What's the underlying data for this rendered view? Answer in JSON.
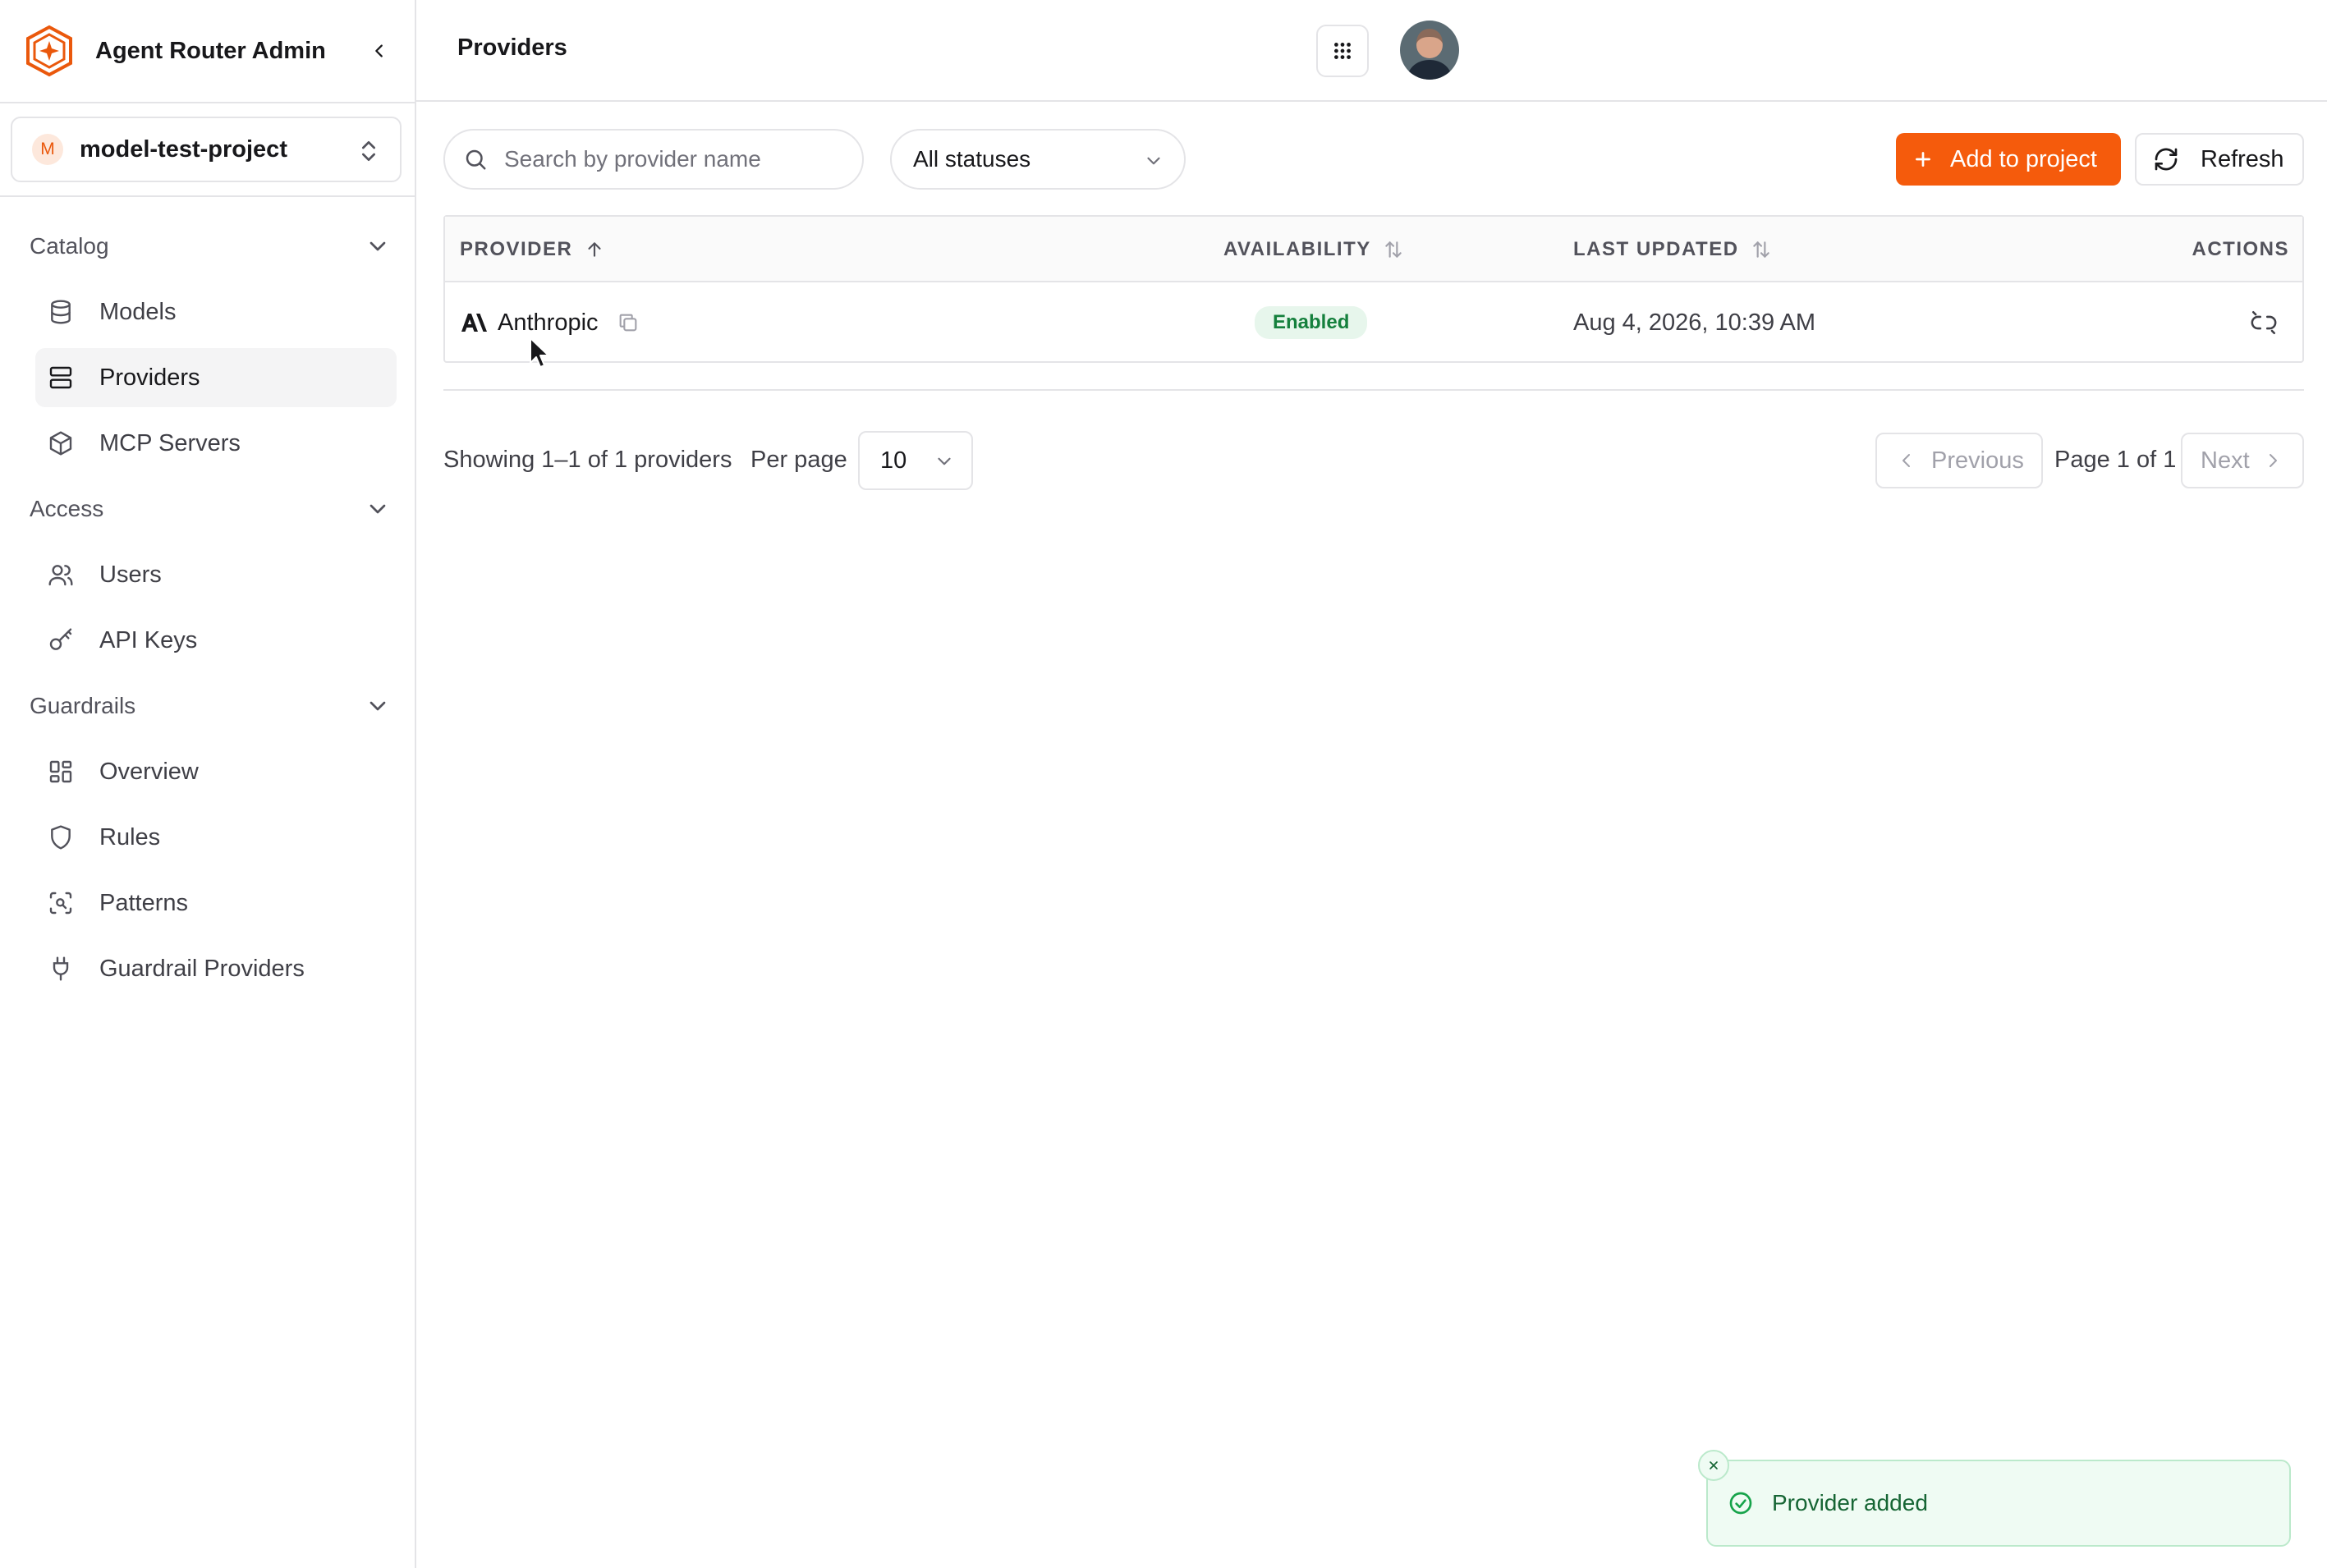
{
  "app": {
    "title": "Agent Router Admin",
    "accent_color": "#f55b0c"
  },
  "project": {
    "initial": "M",
    "name": "model-test-project"
  },
  "sidebar": {
    "sections": [
      {
        "label": "Catalog",
        "items": [
          {
            "label": "Models",
            "icon": "database-icon",
            "active": false
          },
          {
            "label": "Providers",
            "icon": "server-icon",
            "active": true
          },
          {
            "label": "MCP Servers",
            "icon": "package-icon",
            "active": false
          }
        ]
      },
      {
        "label": "Access",
        "items": [
          {
            "label": "Users",
            "icon": "users-icon",
            "active": false
          },
          {
            "label": "API Keys",
            "icon": "key-icon",
            "active": false
          }
        ]
      },
      {
        "label": "Guardrails",
        "items": [
          {
            "label": "Overview",
            "icon": "dashboard-icon",
            "active": false
          },
          {
            "label": "Rules",
            "icon": "shield-icon",
            "active": false
          },
          {
            "label": "Patterns",
            "icon": "scan-search-icon",
            "active": false
          },
          {
            "label": "Guardrail Providers",
            "icon": "plug-icon",
            "active": false
          }
        ]
      }
    ]
  },
  "header": {
    "page_title": "Providers"
  },
  "toolbar": {
    "search_placeholder": "Search by provider name",
    "status_filter": "All statuses",
    "add_label": "Add to project",
    "refresh_label": "Refresh"
  },
  "table": {
    "columns": {
      "provider": "PROVIDER",
      "availability": "AVAILABILITY",
      "last_updated": "LAST UPDATED",
      "actions": "ACTIONS"
    },
    "rows": [
      {
        "provider": "Anthropic",
        "availability": "Enabled",
        "last_updated": "Aug 4, 2026, 10:39 AM"
      }
    ]
  },
  "pagination": {
    "showing": "Showing 1–1 of 1 providers",
    "per_page_label": "Per page",
    "per_page_value": "10",
    "previous_label": "Previous",
    "page_info": "Page 1 of 1",
    "next_label": "Next"
  },
  "toast": {
    "message": "Provider added",
    "status_color": "#16a34a"
  }
}
